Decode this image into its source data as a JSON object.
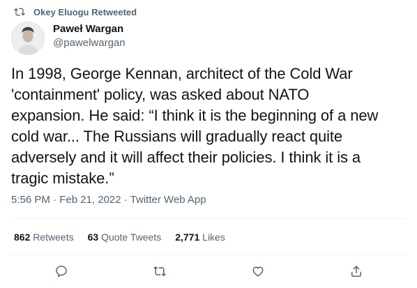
{
  "retweet_context": {
    "icon": "retweet-icon",
    "text": "Okey Eluogu Retweeted"
  },
  "author": {
    "display_name": "Paweł Wargan",
    "handle": "@pawelwargan",
    "avatar_icon": "avatar-photo"
  },
  "tweet": {
    "text": "In 1998, George Kennan, architect of the Cold War\n'containment' policy, was asked about NATO\nexpansion. He said: “I think it is the beginning of a new\ncold war... The Russians will gradually react quite\nadversely and it will affect their policies. I think it is a\ntragic mistake.”",
    "meta": "5:56 PM · Feb 21, 2022 · Twitter Web App"
  },
  "stats": {
    "retweets_count": "862",
    "retweets_label": "Retweets",
    "quotes_count": "63",
    "quotes_label": "Quote Tweets",
    "likes_count": "2,771",
    "likes_label": "Likes"
  },
  "actions": {
    "reply_icon": "reply-icon",
    "retweet_icon": "retweet-icon",
    "like_icon": "heart-icon",
    "share_icon": "share-icon"
  }
}
